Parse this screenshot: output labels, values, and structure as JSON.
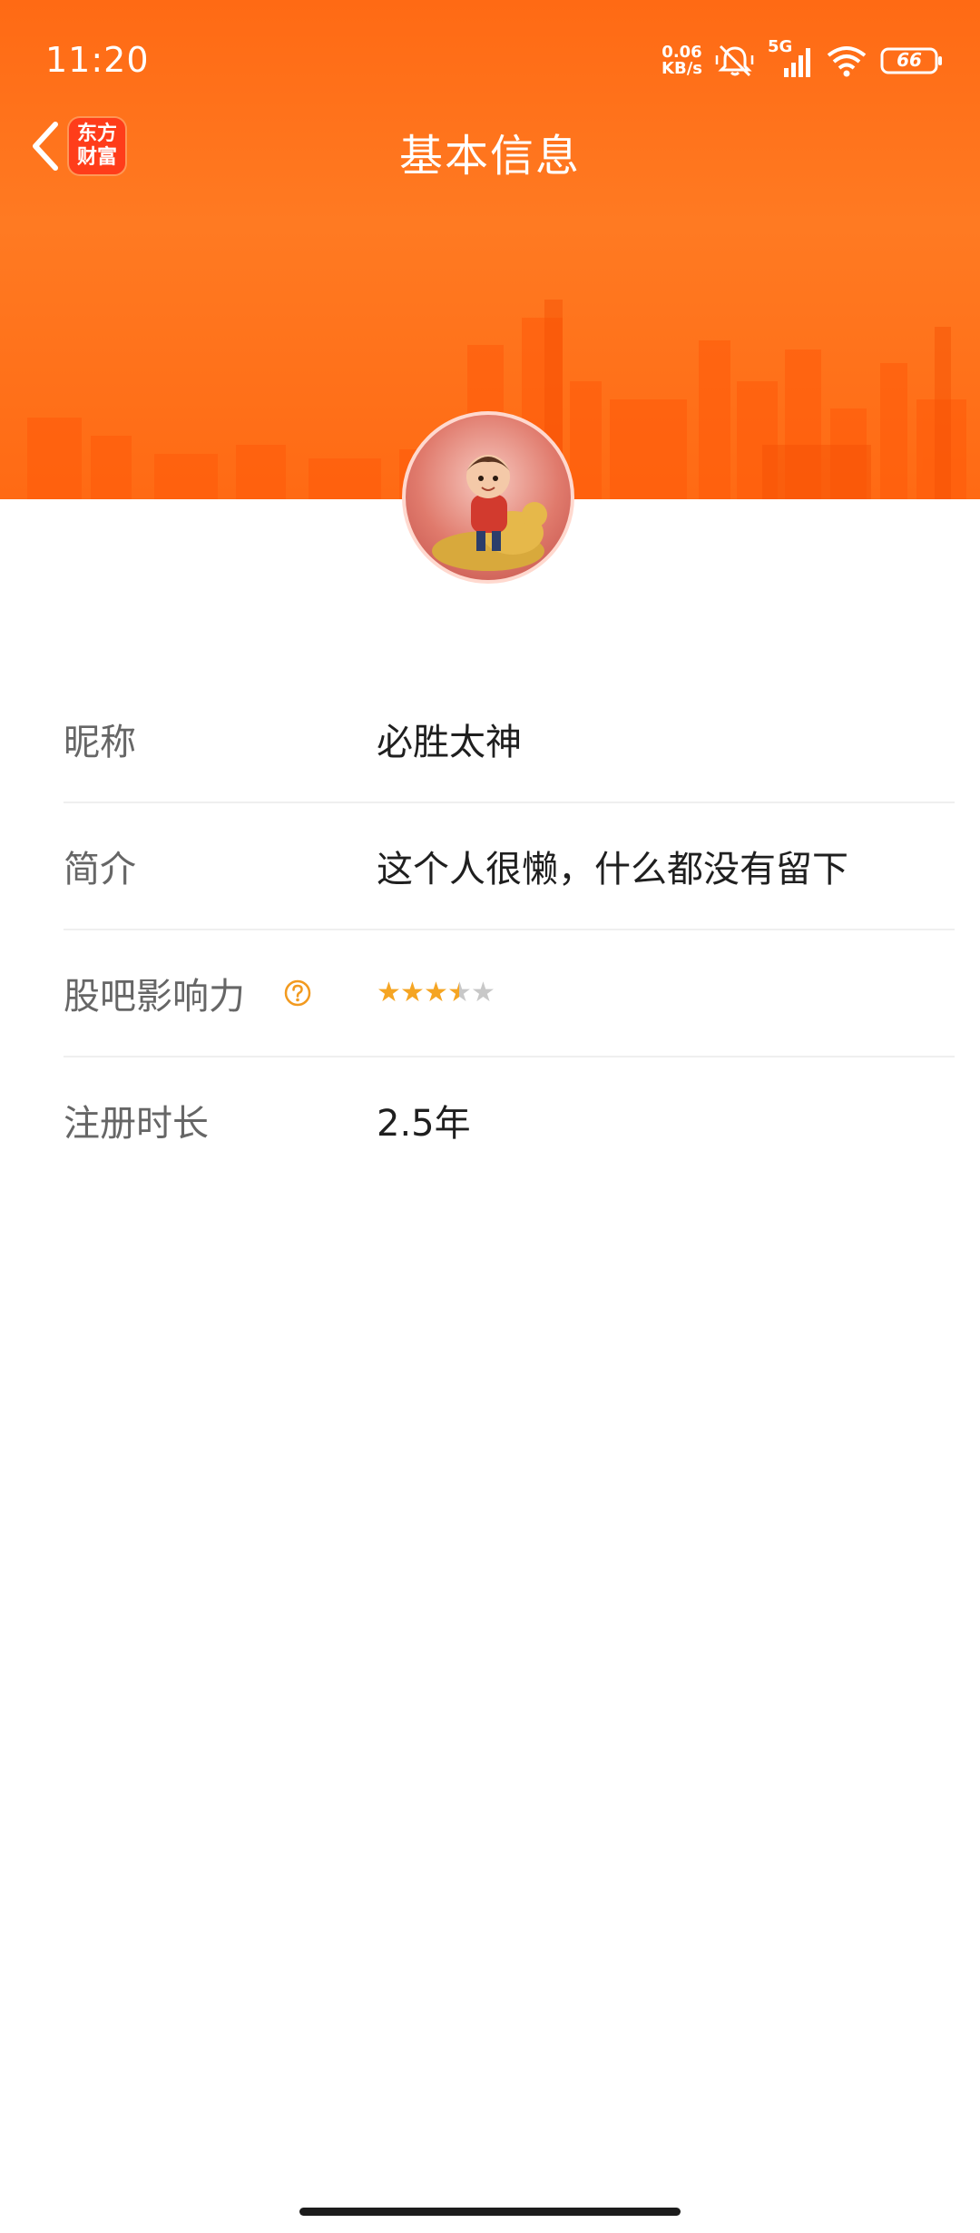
{
  "status_bar": {
    "time": "11:20",
    "net_speed_value": "0.06",
    "net_speed_unit": "KB/s",
    "network": "5G",
    "battery": "66"
  },
  "header": {
    "title": "基本信息",
    "logo_line1": "东方",
    "logo_line2": "财富",
    "banner_color": "#ff6a14"
  },
  "profile": {
    "rows": [
      {
        "label": "昵称",
        "value": "必胜太神"
      },
      {
        "label": "简介",
        "value": "这个人很懒，什么都没有留下"
      },
      {
        "label": "股吧影响力",
        "rating": 3.5,
        "rating_max": 5
      },
      {
        "label": "注册时长",
        "value": "2.5年"
      }
    ]
  },
  "colors": {
    "star_on": "#f5a523",
    "star_off": "#c8c8c8",
    "help_icon": "#f29a1f"
  }
}
